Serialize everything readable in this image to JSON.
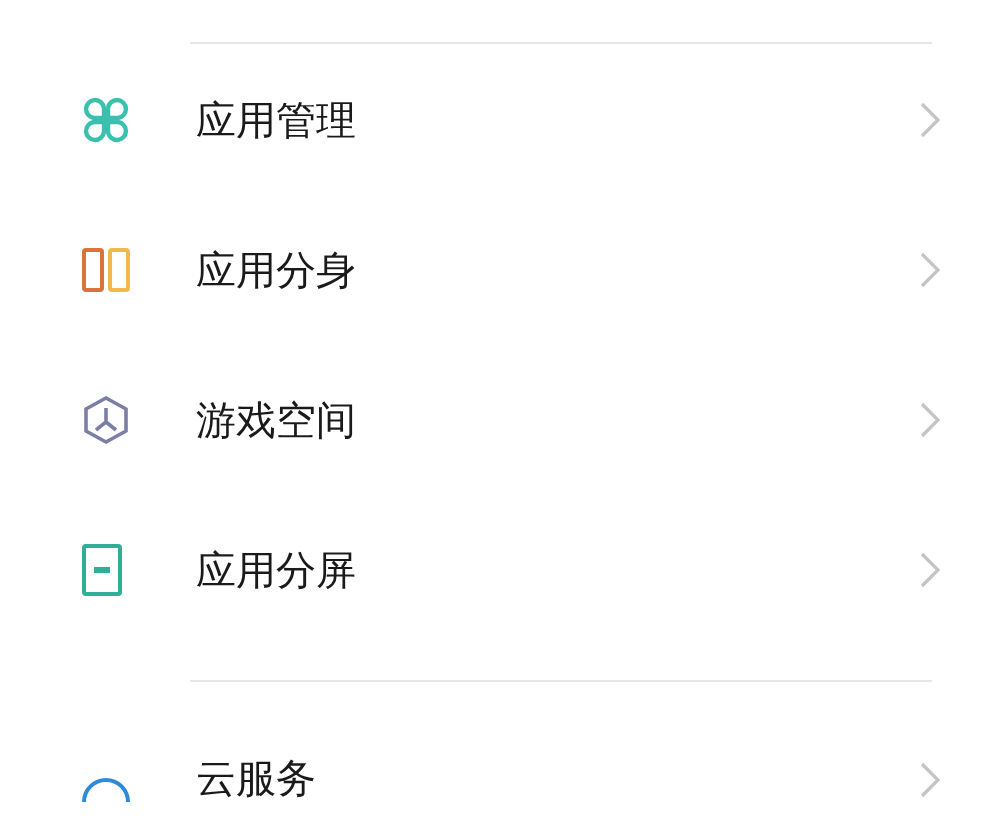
{
  "groups": [
    {
      "items": [
        {
          "kind": "grid",
          "label": "应用管理"
        },
        {
          "kind": "clone",
          "label": "应用分身"
        },
        {
          "kind": "game",
          "label": "游戏空间"
        },
        {
          "kind": "split",
          "label": "应用分屏"
        }
      ]
    },
    {
      "items": [
        {
          "kind": "cloud",
          "label": "云服务"
        }
      ]
    }
  ]
}
